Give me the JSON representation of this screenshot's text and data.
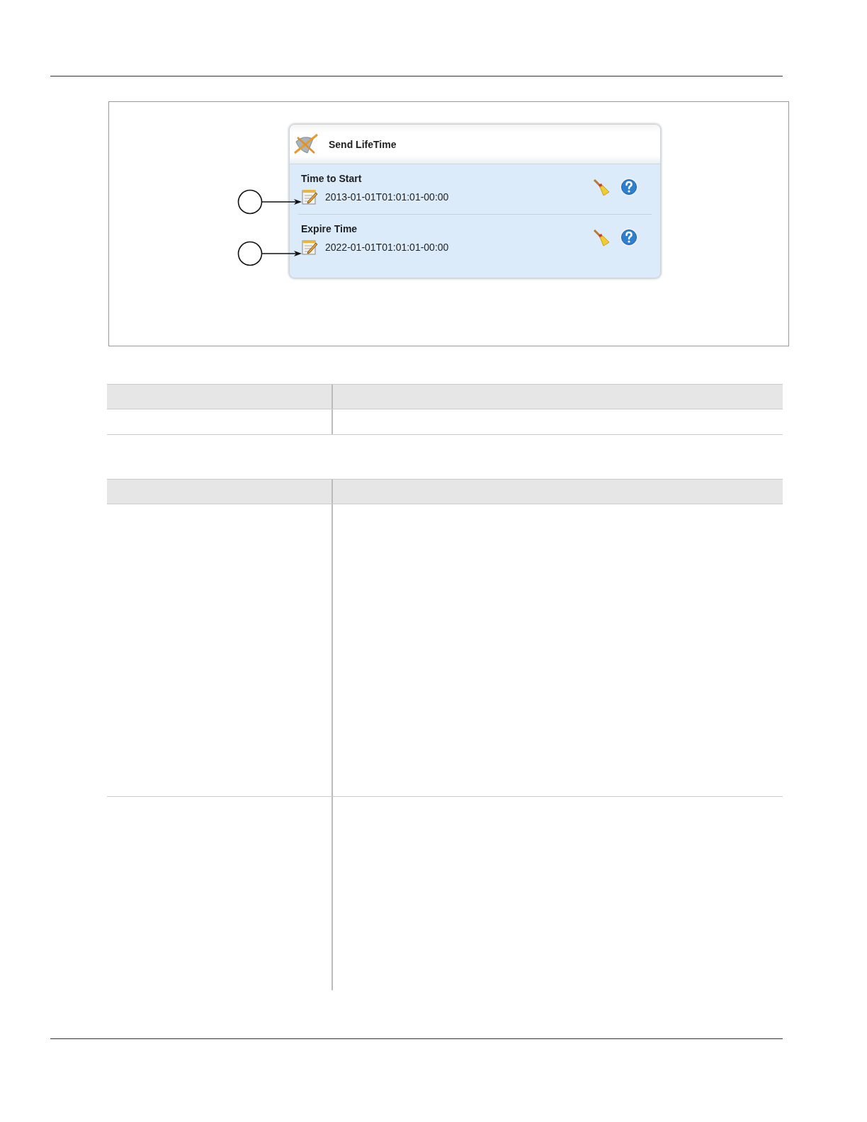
{
  "panel": {
    "title": "Send LifeTime",
    "fields": [
      {
        "label": "Time to Start",
        "value": "2013-01-01T01:01:01-00:00"
      },
      {
        "label": "Expire Time",
        "value": "2022-01-01T01:01:01-00:00"
      }
    ]
  }
}
